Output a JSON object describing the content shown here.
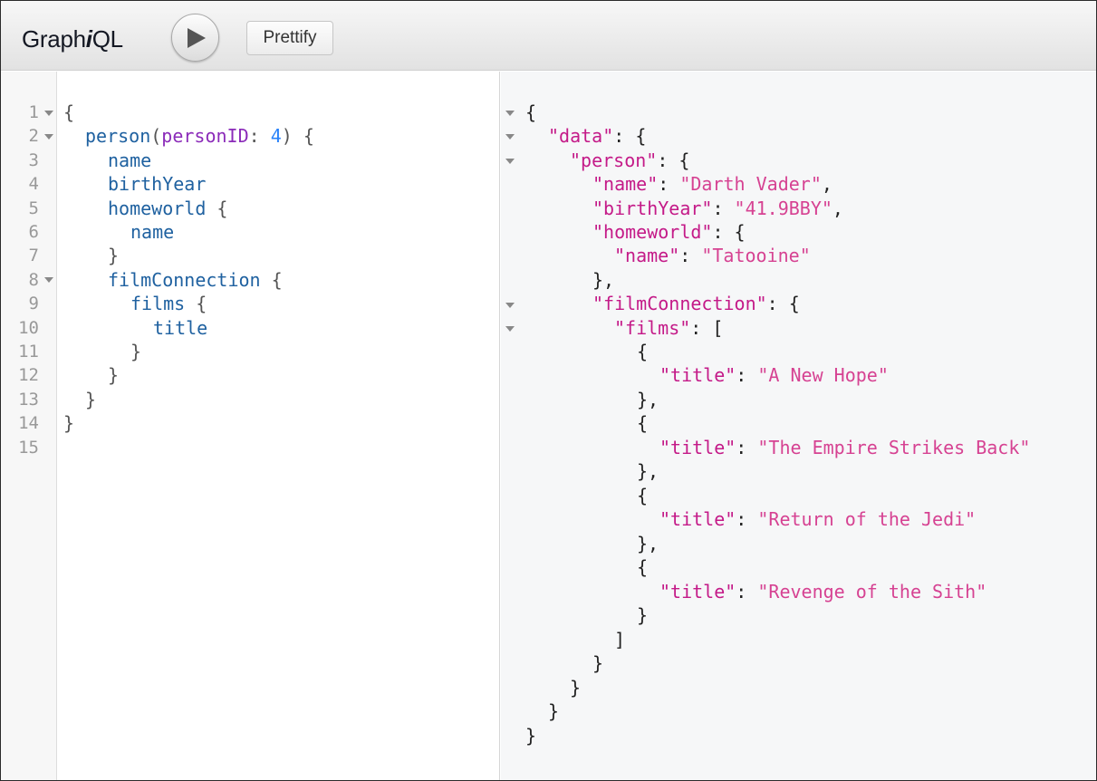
{
  "app": {
    "title_prefix": "Graph",
    "title_em": "i",
    "title_suffix": "QL",
    "run_icon": "play-icon",
    "prettify_label": "Prettify"
  },
  "query": {
    "line_numbers": [
      "1",
      "2",
      "3",
      "4",
      "5",
      "6",
      "7",
      "8",
      "9",
      "10",
      "11",
      "12",
      "13",
      "14",
      "15"
    ],
    "lines": {
      "l1_open": "{",
      "l2_field": "person",
      "l2_paren_open": "(",
      "l2_arg": "personID",
      "l2_colon": ": ",
      "l2_value": "4",
      "l2_paren_close": ") {",
      "l3_field": "name",
      "l4_field": "birthYear",
      "l5_field": "homeworld",
      "l5_brace": " {",
      "l6_field": "name",
      "l7_close": "}",
      "l8_field": "filmConnection",
      "l8_brace": " {",
      "l9_field": "films",
      "l9_brace": " {",
      "l10_field": "title",
      "l11_close": "}",
      "l12_close": "}",
      "l13_close": "}",
      "l14_close": "}"
    }
  },
  "result": {
    "keys": {
      "data": "\"data\"",
      "person": "\"person\"",
      "name": "\"name\"",
      "birthYear": "\"birthYear\"",
      "homeworld": "\"homeworld\"",
      "homeworld_name": "\"name\"",
      "filmConnection": "\"filmConnection\"",
      "films": "\"films\"",
      "title1": "\"title\"",
      "title2": "\"title\"",
      "title3": "\"title\"",
      "title4": "\"title\""
    },
    "values": {
      "name": "\"Darth Vader\"",
      "birthYear": "\"41.9BBY\"",
      "homeworld_name": "\"Tatooine\"",
      "title1": "\"A New Hope\"",
      "title2": "\"The Empire Strikes Back\"",
      "title3": "\"Return of the Jedi\"",
      "title4": "\"Revenge of the Sith\""
    },
    "punct": {
      "open_root": "{",
      "colon_brace": ": {",
      "colon": ": ",
      "comma": ",",
      "colon_bracket": ": [",
      "open_obj": "{",
      "close_obj_comma": "},",
      "close_obj": "}",
      "close_arr": "]",
      "close_root": "}"
    }
  },
  "colors": {
    "field": "#1f61a0",
    "argument": "#8b2bb9",
    "number": "#2882f9",
    "json_key": "#c41a88",
    "json_string": "#d64292"
  }
}
